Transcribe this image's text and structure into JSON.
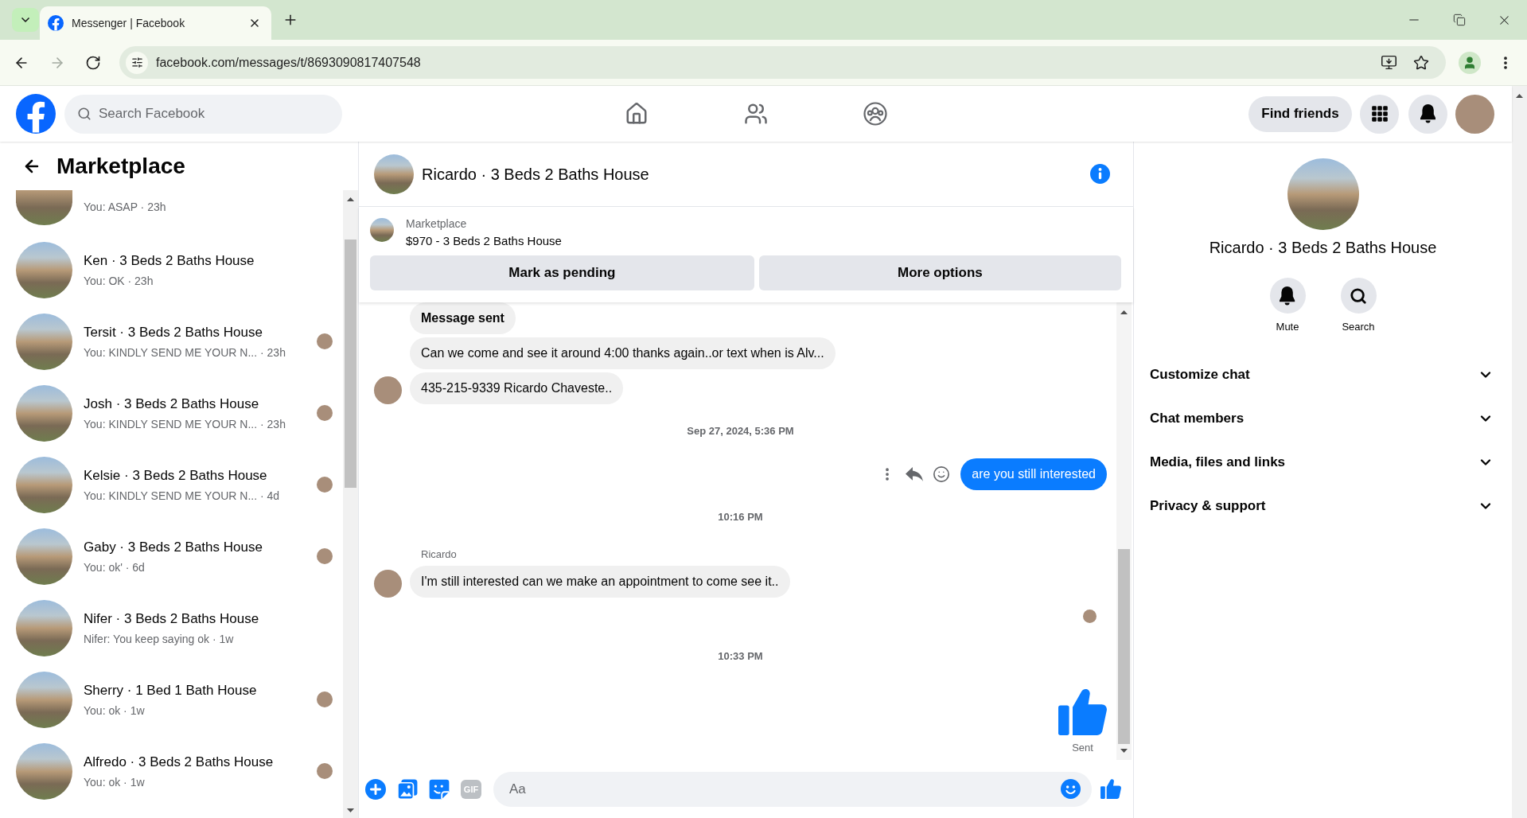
{
  "browser": {
    "tabs": [
      {
        "title": "Messenger | Facebook",
        "selected": true
      }
    ],
    "nav_buttons": [
      {
        "kind": "back",
        "disabled": false
      },
      {
        "kind": "forward",
        "disabled": true
      },
      {
        "kind": "reload",
        "disabled": false
      }
    ],
    "url": "facebook.com/messages/t/8693090817407548"
  },
  "header": {
    "search": {
      "placeholder": "Search Facebook"
    },
    "nav": [
      {
        "kind": "home"
      },
      {
        "kind": "friends"
      },
      {
        "kind": "groups"
      }
    ],
    "find_friends": "Find friends"
  },
  "sidebar": {
    "title": "Marketplace",
    "conversations": [
      {
        "snippet": "You: ASAP · 23h",
        "seen": false
      },
      {
        "name": "Ken · 3 Beds 2 Baths House",
        "snippet": "You: OK · 23h",
        "seen": false
      },
      {
        "name": "Tersit · 3 Beds 2 Baths House",
        "snippet": "You: KINDLY SEND ME YOUR N... · 23h",
        "seen": true
      },
      {
        "name": "Josh · 3 Beds 2 Baths House",
        "snippet": "You: KINDLY SEND ME YOUR N... · 23h",
        "seen": true
      },
      {
        "name": "Kelsie · 3 Beds 2 Baths House",
        "snippet": "You: KINDLY SEND ME YOUR N... · 4d",
        "seen": true
      },
      {
        "name": "Gaby · 3 Beds 2 Baths House",
        "snippet": "You: ok' · 6d",
        "seen": true
      },
      {
        "name": "Nifer · 3 Beds 2 Baths House",
        "snippet": "Nifer: You keep saying ok · 1w",
        "seen": false
      },
      {
        "name": "Sherry · 1 Bed 1 Bath House",
        "snippet": "You: ok · 1w",
        "seen": true
      },
      {
        "name": "Alfredo · 3 Beds 2 Baths House",
        "snippet": "You: ok · 1w",
        "seen": true
      }
    ]
  },
  "chat": {
    "title": "Ricardo · 3 Beds 2 Baths House",
    "listing": {
      "label": "Marketplace",
      "title": "$970 - 3 Beds 2 Baths House",
      "actions": [
        "Mark as pending",
        "More options"
      ]
    },
    "messages": [
      {
        "kind": "incoming",
        "text": "Message sent",
        "bold": true,
        "avatar": false
      },
      {
        "kind": "incoming",
        "text": "Can we come and see it around 4:00 thanks again..or text when is Alv...",
        "bold": false,
        "avatar": false
      },
      {
        "kind": "incoming",
        "text": "435-215-9339 Ricardo Chaveste..",
        "bold": false,
        "avatar": true
      },
      {
        "kind": "timestamp",
        "text": "Sep 27, 2024, 5:36 PM"
      },
      {
        "kind": "outgoing",
        "text": "are you still interested",
        "actions": [
          {
            "kind": "more"
          },
          {
            "kind": "reply"
          },
          {
            "kind": "react"
          }
        ]
      },
      {
        "kind": "timestamp",
        "text": "10:16 PM"
      },
      {
        "kind": "incoming",
        "sender": "Ricardo",
        "text": "I'm still interested can we make an appointment to come see it..",
        "bold": false,
        "avatar": true
      },
      {
        "kind": "seen"
      },
      {
        "kind": "timestamp",
        "text": "10:33 PM"
      },
      {
        "kind": "like",
        "status": "Sent"
      }
    ],
    "composer": {
      "tools": [
        {
          "kind": "plus"
        },
        {
          "kind": "photo"
        },
        {
          "kind": "sticker"
        },
        {
          "kind": "gif",
          "label": "GIF"
        }
      ],
      "placeholder": "Aa"
    }
  },
  "details": {
    "name": "Ricardo · 3 Beds 2 Baths House",
    "actions": [
      {
        "kind": "mute",
        "label": "Mute"
      },
      {
        "kind": "search",
        "label": "Search"
      }
    ],
    "sections": [
      {
        "label": "Customize chat",
        "expanded": false
      },
      {
        "label": "Chat members",
        "expanded": false
      },
      {
        "label": "Media, files and links",
        "expanded": false
      },
      {
        "label": "Privacy & support",
        "expanded": false
      }
    ]
  }
}
